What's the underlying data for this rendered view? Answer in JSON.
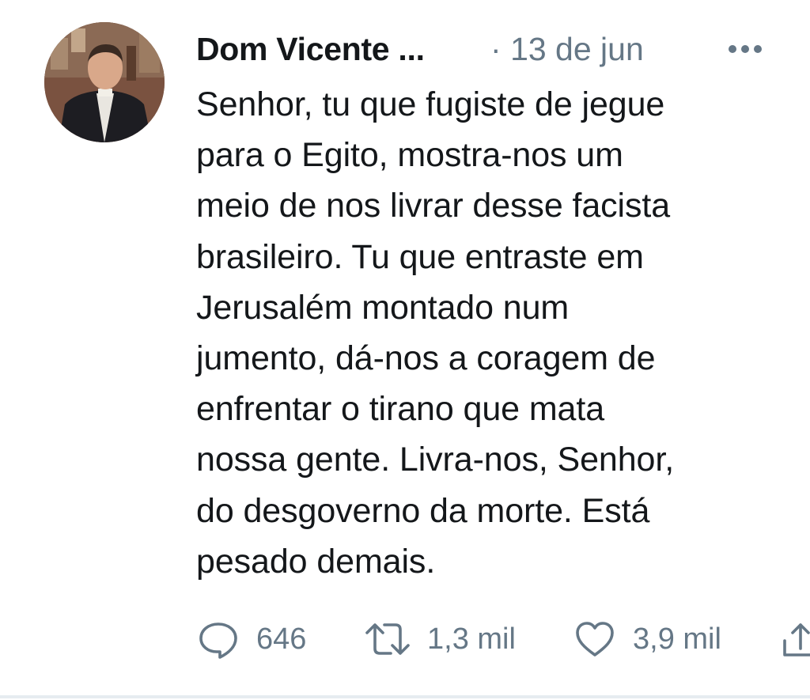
{
  "tweet": {
    "author_name": "Dom Vicente ...",
    "separator": "·",
    "date": "13 de jun",
    "text": "Senhor, tu que fugiste de jegue\npara o Egito, mostra-nos um\nmeio de nos livrar desse facista\nbrasileiro. Tu que entraste em\nJerusalém montado num\njumento, dá-nos a coragem de\nenfrentar o tirano que mata\nnossa gente. Livra-nos, Senhor,\ndo desgoverno da morte. Está\npesado demais."
  },
  "actions": {
    "reply_count": "646",
    "retweet_count": "1,3 mil",
    "like_count": "3,9 mil"
  },
  "icons": {
    "more": "more-dots-icon",
    "reply": "reply-bubble-icon",
    "retweet": "retweet-arrows-icon",
    "like": "heart-icon",
    "share": "share-icon"
  },
  "colors": {
    "text": "#14171a",
    "secondary": "#657786",
    "divider": "#e6ecf0"
  }
}
